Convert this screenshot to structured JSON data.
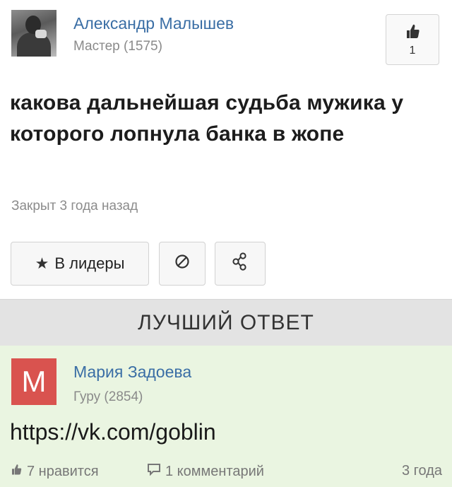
{
  "question": {
    "author_name": "Александр Малышев",
    "author_rank": "Мастер (1575)",
    "like_count": "1",
    "text": "какова дальнейшая судьба мужика у которого лопнула банка в жопе",
    "status": "Закрыт 3 года назад",
    "buttons": {
      "leaders_label": "В лидеры"
    },
    "icons": {
      "like": "thumbs-up-icon",
      "star": "star-icon",
      "block": "block-icon",
      "share": "share-icon"
    }
  },
  "best_answer": {
    "section_title": "ЛУЧШИЙ ОТВЕТ",
    "avatar_letter": "М",
    "author_name": "Мария Задоева",
    "author_rank": "Гуру (2854)",
    "text": "https://vk.com/goblin",
    "likes_label": "7 нравится",
    "comments_label": "1 комментарий",
    "time": "3 года",
    "colors": {
      "avatar": "#d9534f",
      "background": "#eaf5e1",
      "link_name": "#3a6ea5"
    }
  }
}
